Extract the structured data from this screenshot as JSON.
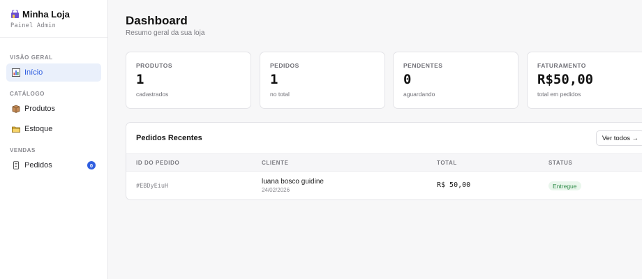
{
  "brand": {
    "title": "Minha Loja",
    "subtitle": "Painel Admin",
    "icon": "store-icon"
  },
  "sidebar": {
    "sections": [
      {
        "label": "VISÃO GERAL"
      },
      {
        "label": "CATÁLOGO"
      },
      {
        "label": "VENDAS"
      }
    ],
    "items": [
      {
        "label": "Início",
        "icon": "bar-chart-icon",
        "active": true
      },
      {
        "label": "Produtos",
        "icon": "package-icon"
      },
      {
        "label": "Estoque",
        "icon": "folder-icon"
      },
      {
        "label": "Pedidos",
        "icon": "scroll-icon",
        "badge": "0"
      }
    ]
  },
  "header": {
    "title": "Dashboard",
    "subtitle": "Resumo geral da sua loja"
  },
  "stats": [
    {
      "label": "PRODUTOS",
      "value": "1",
      "caption": "cadastrados"
    },
    {
      "label": "PEDIDOS",
      "value": "1",
      "caption": "no total"
    },
    {
      "label": "PENDENTES",
      "value": "0",
      "caption": "aguardando"
    },
    {
      "label": "FATURAMENTO",
      "value": "R$50,00",
      "caption": "total em pedidos"
    }
  ],
  "recent_orders": {
    "title": "Pedidos Recentes",
    "view_all_label": "Ver todos →",
    "columns": [
      "ID DO PEDIDO",
      "CLIENTE",
      "TOTAL",
      "STATUS"
    ],
    "rows": [
      {
        "id": "#EBDyEiuH",
        "client": "luana bosco guidine",
        "date": "24/02/2026",
        "total": "R$ 50,00",
        "status": "Entregue"
      }
    ]
  },
  "colors": {
    "accent": "#2f5ee0",
    "status_delivered": "#2e8b48"
  }
}
